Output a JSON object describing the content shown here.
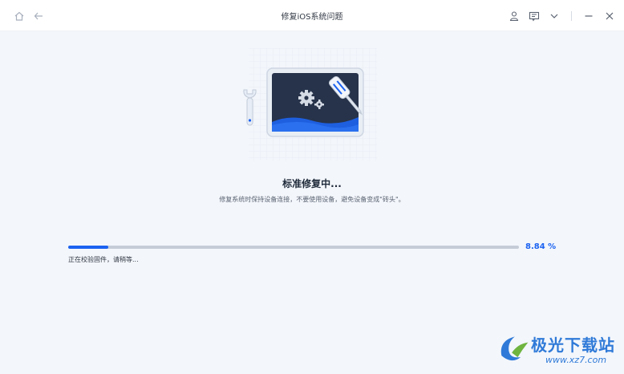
{
  "window": {
    "title": "修复iOS系统问题"
  },
  "titlebar": {
    "icons": [
      "home-icon",
      "back-icon",
      "user-icon",
      "feedback-icon",
      "chevron-down-icon",
      "minimize-icon",
      "close-icon"
    ]
  },
  "status": {
    "title": "标准修复中...",
    "description": "修复系统时保持设备连接，不要使用设备，避免设备变成\"砖头\"。"
  },
  "progress": {
    "percent": 8.84,
    "percent_label": "8.84 %",
    "message": "正在校验固件，请稍等..."
  },
  "watermark": {
    "text": "极光下载站",
    "url": "www.xz7.com"
  },
  "colors": {
    "accent": "#1b62f1",
    "track": "#c5ccd8",
    "screen": "#27334a",
    "wave": "#1e5fe0"
  }
}
